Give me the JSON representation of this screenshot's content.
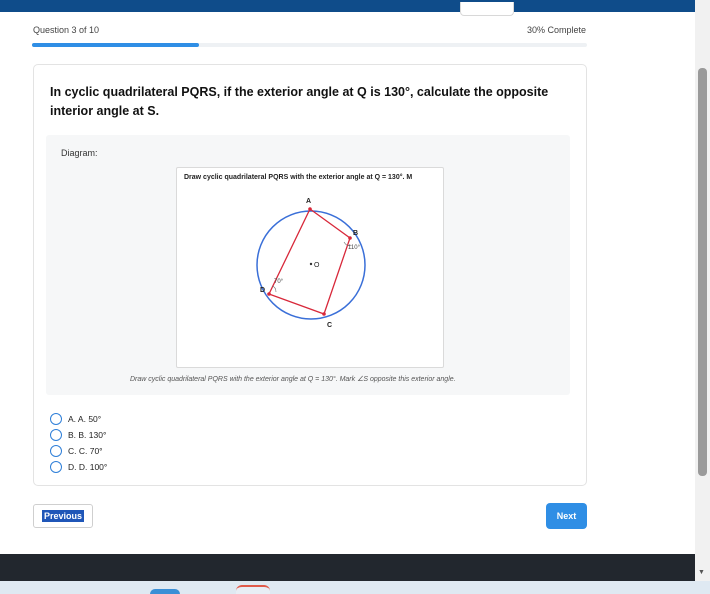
{
  "progress": {
    "question_label": "Question 3 of 10",
    "percent_label": "30% Complete",
    "fraction": 0.3
  },
  "question": {
    "text": "In cyclic quadrilateral PQRS, if the exterior angle at Q is 130°, calculate the opposite interior angle at S."
  },
  "diagram": {
    "label": "Diagram:",
    "title": "Draw cyclic quadrilateral PQRS with the exterior angle at Q = 130°. M",
    "caption": "Draw cyclic quadrilateral PQRS with the exterior angle at Q = 130°. Mark ∠S opposite this exterior angle.",
    "vertices": {
      "a": "A",
      "b": "B",
      "c": "C",
      "d": "D"
    },
    "center_label": "O",
    "angle_b": "110°",
    "angle_d": "70°",
    "colors": {
      "circle": "#3a6fd8",
      "quad": "#d8283a"
    }
  },
  "options": [
    {
      "label": "A. A. 50°"
    },
    {
      "label": "B. B. 130°"
    },
    {
      "label": "C. C. 70°"
    },
    {
      "label": "D. D. 100°"
    }
  ],
  "nav": {
    "previous_label": "Previous",
    "next_label": "Next"
  },
  "colors": {
    "accent": "#2f8ee5",
    "header": "#0f4c8a",
    "footer": "#22272e"
  }
}
